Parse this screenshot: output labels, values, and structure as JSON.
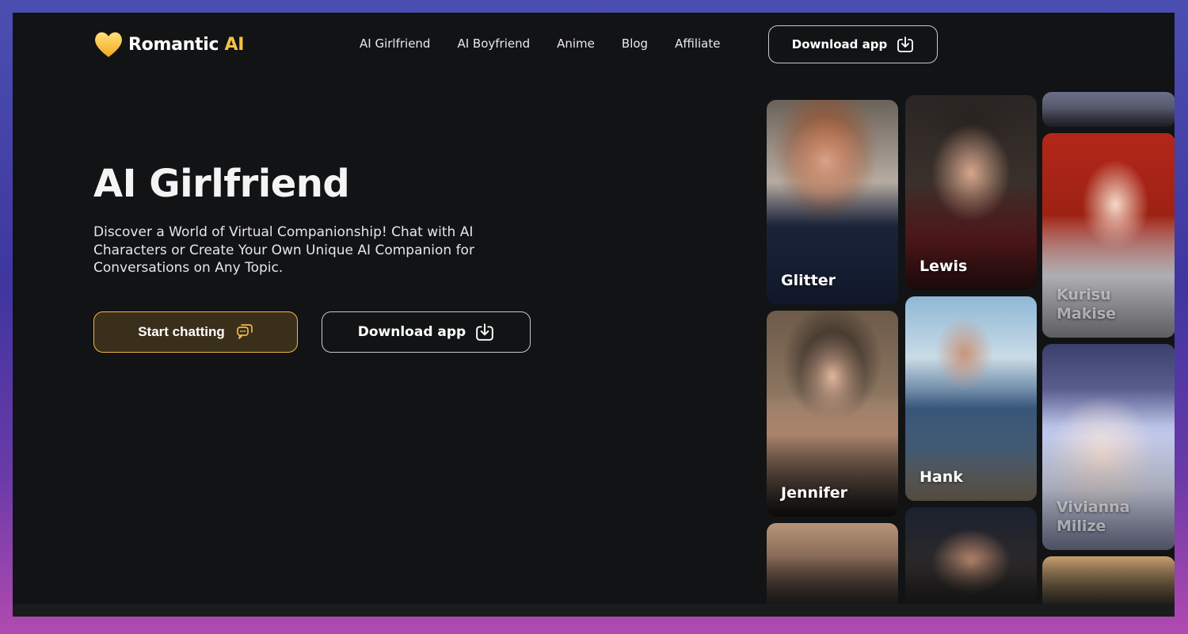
{
  "brand": {
    "name_main": "Romantic ",
    "name_accent": "AI",
    "logo_icon": "heart-icon"
  },
  "nav": {
    "items": [
      {
        "label": "AI Girlfriend"
      },
      {
        "label": "AI Boyfriend"
      },
      {
        "label": "Anime"
      },
      {
        "label": "Blog"
      },
      {
        "label": "Affiliate"
      }
    ],
    "download_label": "Download app"
  },
  "hero": {
    "title": "AI Girlfriend",
    "description": "Discover a World of Virtual Companionship! Chat with AI Characters or Create Your Own Unique AI Companion for Conversations on Any Topic.",
    "start_label": "Start chatting",
    "download_label": "Download app"
  },
  "characters": [
    {
      "name": "Glitter"
    },
    {
      "name": "Lewis"
    },
    {
      "name": "Kurisu Makise"
    },
    {
      "name": "Jennifer"
    },
    {
      "name": "Hank"
    },
    {
      "name": "Vivianna Milize"
    }
  ],
  "colors": {
    "accent": "#f5c242",
    "background": "#121314",
    "start_border": "#f0b64a"
  }
}
